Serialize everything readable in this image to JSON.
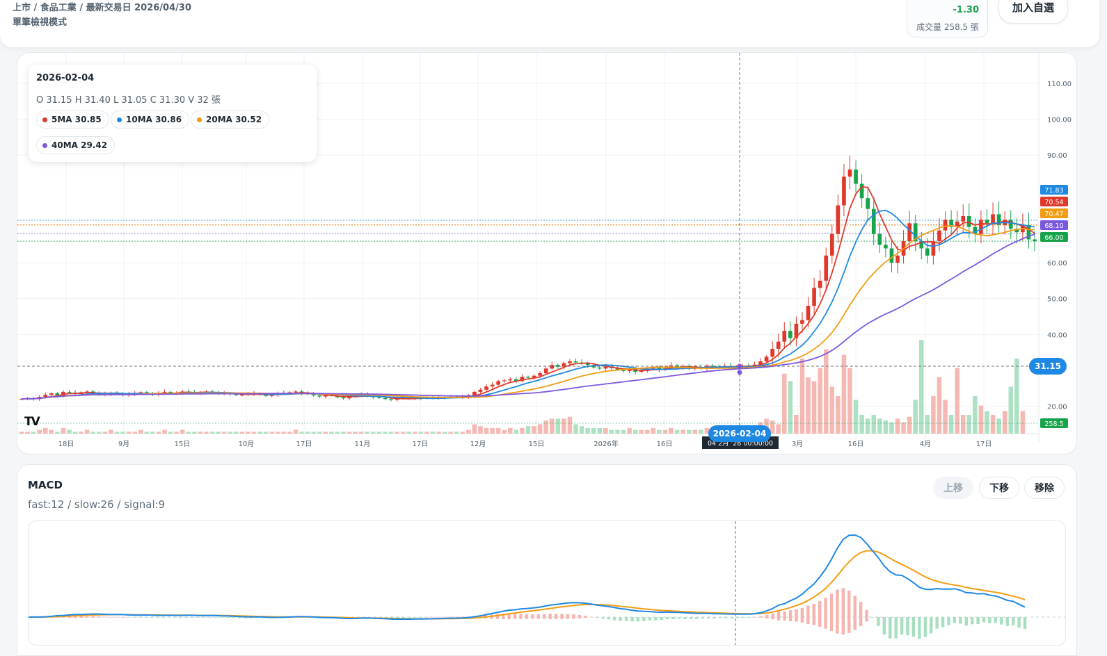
{
  "header": {
    "breadcrumb": "上市 / 食品工業 / 最新交易日 2026/04/30",
    "mode": "單筆檢視模式",
    "change": "-1.30",
    "volume": "成交量 258.5 張",
    "watch_button": "加入自選"
  },
  "legend": {
    "date": "2026-02-04",
    "ohlc": "O 31.15   H 31.40   L 31.05   C 31.30   V 32 張",
    "ma": [
      {
        "label": "5MA 30.85",
        "color": "#e0392b"
      },
      {
        "label": "10MA 30.86",
        "color": "#1e88e5"
      },
      {
        "label": "20MA 30.52",
        "color": "#f39c12"
      },
      {
        "label": "40MA 29.42",
        "color": "#7b57e0"
      }
    ]
  },
  "logo_text": "TV",
  "macd": {
    "title": "MACD",
    "params": "fast:12 / slow:26 / signal:9",
    "up_button": "上移",
    "down_button": "下移",
    "remove_button": "移除"
  },
  "chart_data": [
    {
      "type": "candlestick",
      "name": "price",
      "x_ticks": [
        "18日",
        "9月",
        "15日",
        "10月",
        "17日",
        "11月",
        "17日",
        "12月",
        "15日",
        "2026年",
        "16日",
        "3月",
        "16日",
        "4月",
        "17日"
      ],
      "y_ticks": [
        110,
        100,
        90,
        60,
        50,
        40,
        20
      ],
      "y_range": [
        15,
        115
      ],
      "crosshair": {
        "date": "2026-02-04",
        "price": "31.15",
        "time_label": "04 2月 '26   00:00:00"
      },
      "price_badges": [
        {
          "label": "71.83",
          "value": 71.83,
          "color": "#1e88e5"
        },
        {
          "label": "70.54",
          "value": 70.54,
          "color": "#e0392b"
        },
        {
          "label": "70.47",
          "value": 70.47,
          "color": "#f39c12"
        },
        {
          "label": "68.10",
          "value": 68.1,
          "color": "#7b57e0"
        },
        {
          "label": "66.00",
          "value": 66.0,
          "color": "#17a34a"
        }
      ],
      "volume_badge": "258.5",
      "series": [
        {
          "name": "5MA",
          "color": "#e0392b"
        },
        {
          "name": "10MA",
          "color": "#1e88e5"
        },
        {
          "name": "20MA",
          "color": "#f39c12"
        },
        {
          "name": "40MA",
          "color": "#7b57e0"
        }
      ],
      "close": [
        22.0,
        22.2,
        22.0,
        22.6,
        23.2,
        23.6,
        23.0,
        24.0,
        23.8,
        23.4,
        23.9,
        24.1,
        23.6,
        23.2,
        23.4,
        23.8,
        23.5,
        23.1,
        23.4,
        23.6,
        23.9,
        23.5,
        23.3,
        23.7,
        24.0,
        23.6,
        23.8,
        24.1,
        23.9,
        23.6,
        23.9,
        24.1,
        23.8,
        23.5,
        23.6,
        23.4,
        23.1,
        23.2,
        23.4,
        23.6,
        23.2,
        22.9,
        23.1,
        23.5,
        23.7,
        23.9,
        24.1,
        23.6,
        23.3,
        23.0,
        22.7,
        23.1,
        23.0,
        22.5,
        22.2,
        22.6,
        23.0,
        23.4,
        22.9,
        22.5,
        22.3,
        22.0,
        21.8,
        22.1,
        22.3,
        22.1,
        22.3,
        22.2,
        22.4,
        22.3,
        22.5,
        22.4,
        22.6,
        22.5,
        22.6,
        23.1,
        24.0,
        24.6,
        25.5,
        26.0,
        27.0,
        27.2,
        27.5,
        27.0,
        28.2,
        28.0,
        28.5,
        29.2,
        30.5,
        31.5,
        31.0,
        32.0,
        32.5,
        32.2,
        32.0,
        31.5,
        30.8,
        30.5,
        31.0,
        30.6,
        30.2,
        29.8,
        30.4,
        29.6,
        29.8,
        30.5,
        30.8,
        30.2,
        30.6,
        31.4,
        30.8,
        31.2,
        30.4,
        30.8,
        30.6,
        31.3,
        31.0,
        30.8,
        31.2,
        31.0,
        31.1,
        31.3,
        31.2,
        31.6,
        32.5,
        33.8,
        36.0,
        38.0,
        41.0,
        39.0,
        43.0,
        44.0,
        48.0,
        53.0,
        55.0,
        62.0,
        68.0,
        76.0,
        84.0,
        86.0,
        82.0,
        78.0,
        75.0,
        68.0,
        65.0,
        64.0,
        60.0,
        62.0,
        66.0,
        71.0,
        66.0,
        64.0,
        62.0,
        66.0,
        69.0,
        72.0,
        70.0,
        71.5,
        73.0,
        70.0,
        68.0,
        72.0,
        71.0,
        73.5,
        70.5,
        72.0,
        69.5,
        68.5,
        70.5,
        66.5,
        66.0
      ],
      "volume": [
        1,
        1,
        1,
        2,
        3,
        2,
        1,
        3,
        2,
        1,
        1,
        2,
        1,
        1,
        1,
        2,
        1,
        1,
        1,
        1,
        2,
        1,
        1,
        1,
        2,
        1,
        1,
        2,
        1,
        1,
        1,
        1,
        1,
        1,
        1,
        1,
        1,
        1,
        1,
        1,
        1,
        1,
        1,
        1,
        1,
        1,
        2,
        1,
        1,
        1,
        1,
        1,
        1,
        1,
        1,
        1,
        1,
        1,
        1,
        1,
        1,
        1,
        1,
        1,
        1,
        1,
        1,
        1,
        1,
        1,
        1,
        1,
        1,
        1,
        1,
        2,
        5,
        4,
        3,
        3,
        3,
        2,
        3,
        2,
        3,
        4,
        4,
        5,
        7,
        8,
        8,
        8,
        9,
        5,
        4,
        3,
        3,
        3,
        3,
        2,
        2,
        2,
        3,
        2,
        2,
        2,
        3,
        2,
        2,
        3,
        2,
        2,
        2,
        2,
        2,
        3,
        2,
        2,
        2,
        2,
        2,
        3,
        2,
        3,
        6,
        8,
        7,
        5,
        32,
        28,
        10,
        40,
        30,
        28,
        35,
        45,
        25,
        20,
        42,
        35,
        18,
        10,
        8,
        10,
        8,
        7,
        6,
        8,
        6,
        9,
        18,
        50,
        10,
        20,
        30,
        18,
        10,
        35,
        10,
        10,
        20,
        15,
        12,
        10,
        8,
        12,
        25,
        40,
        12
      ]
    },
    {
      "type": "macd",
      "name": "MACD",
      "series": [
        {
          "name": "MACD",
          "color": "#1e88e5"
        },
        {
          "name": "Signal",
          "color": "#f39c12"
        }
      ]
    }
  ]
}
